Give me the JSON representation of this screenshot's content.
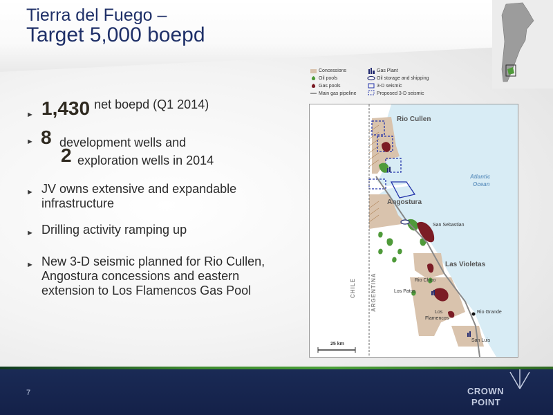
{
  "title": {
    "line1": "Tierra del Fuego –",
    "line2": "Target 5,000 boepd"
  },
  "bullets": {
    "b1": {
      "big": "1,430",
      "text": "net boepd (Q1 2014)"
    },
    "b2": {
      "big1": "8",
      "text1": "development wells and",
      "big2": "2",
      "text2": "exploration wells in 2014"
    },
    "b3": "JV owns extensive and expandable infrastructure",
    "b4": "Drilling activity ramping up",
    "b5": "New 3-D seismic planned for Rio Cullen, Angostura concessions and eastern extension to Los Flamencos Gas Pool"
  },
  "legend": {
    "concessions": "Concessions",
    "oil_pools": "Oil pools",
    "gas_pools": "Gas pools",
    "main_gas_pipeline": "Main gas pipeline",
    "gas_plant": "Gas Plant",
    "oil_storage": "Oil storage and shipping",
    "seismic_3d": "3-D seismic",
    "proposed_3d": "Proposed 3-D seismic"
  },
  "map": {
    "rio_cullen": "Rio Cullen",
    "atlantic": "Atlantic",
    "ocean": "Ocean",
    "angostura": "Angostura",
    "san_sebastian": "San Sebastian",
    "las_violetas": "Las Violetas",
    "rio_chico": "Rio Chico",
    "los_patos": "Los Patos",
    "los_flamencos_1": "Los",
    "los_flamencos_2": "Flamencos",
    "rio_grande": "Rio Grande",
    "san_luis": "San Luis",
    "chile": "CHILE",
    "argentina": "ARGENTINA",
    "scale": "25 km"
  },
  "footer": {
    "page_number": "7",
    "logo_line1": "CROWN",
    "logo_line2": "POINT"
  },
  "colors": {
    "title": "#1f3068",
    "concession": "#d9c3ad",
    "oil_pool": "#4f9a3a",
    "gas_pool": "#7b1c25",
    "water": "#d8ecf5",
    "seismic": "#2233aa"
  },
  "icons": [
    "bullet-arrow-icon",
    "gas-plant-icon",
    "oil-storage-icon",
    "crown-point-logo"
  ]
}
